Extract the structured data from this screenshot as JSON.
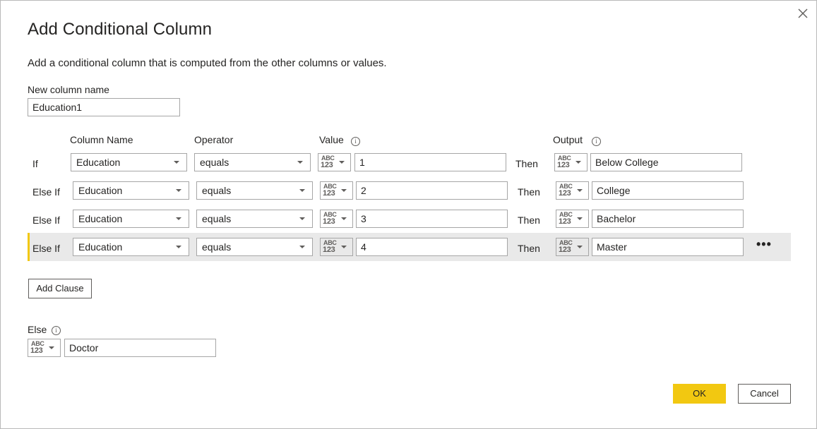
{
  "dialog": {
    "title": "Add Conditional Column",
    "subtitle": "Add a conditional column that is computed from the other columns or values.",
    "close_icon": "close-icon"
  },
  "new_column": {
    "label": "New column name",
    "value": "Education1"
  },
  "headers": {
    "column_name": "Column Name",
    "operator": "Operator",
    "value": "Value",
    "output": "Output"
  },
  "type_icon": {
    "abc": "ABC",
    "num": "123"
  },
  "clauses": [
    {
      "keyword": "If",
      "column": "Education",
      "operator": "equals",
      "value": "1",
      "then": "Then",
      "output": "Below College"
    },
    {
      "keyword": "Else If",
      "column": "Education",
      "operator": "equals",
      "value": "2",
      "then": "Then",
      "output": "College"
    },
    {
      "keyword": "Else If",
      "column": "Education",
      "operator": "equals",
      "value": "3",
      "then": "Then",
      "output": "Bachelor"
    },
    {
      "keyword": "Else If",
      "column": "Education",
      "operator": "equals",
      "value": "4",
      "then": "Then",
      "output": "Master"
    }
  ],
  "more_label": "•••",
  "add_clause_label": "Add Clause",
  "else": {
    "label": "Else",
    "value": "Doctor"
  },
  "buttons": {
    "ok": "OK",
    "cancel": "Cancel"
  },
  "colors": {
    "accent": "#f2c811",
    "highlight_row": "#e9e9e9",
    "border": "#a6a6a6"
  }
}
